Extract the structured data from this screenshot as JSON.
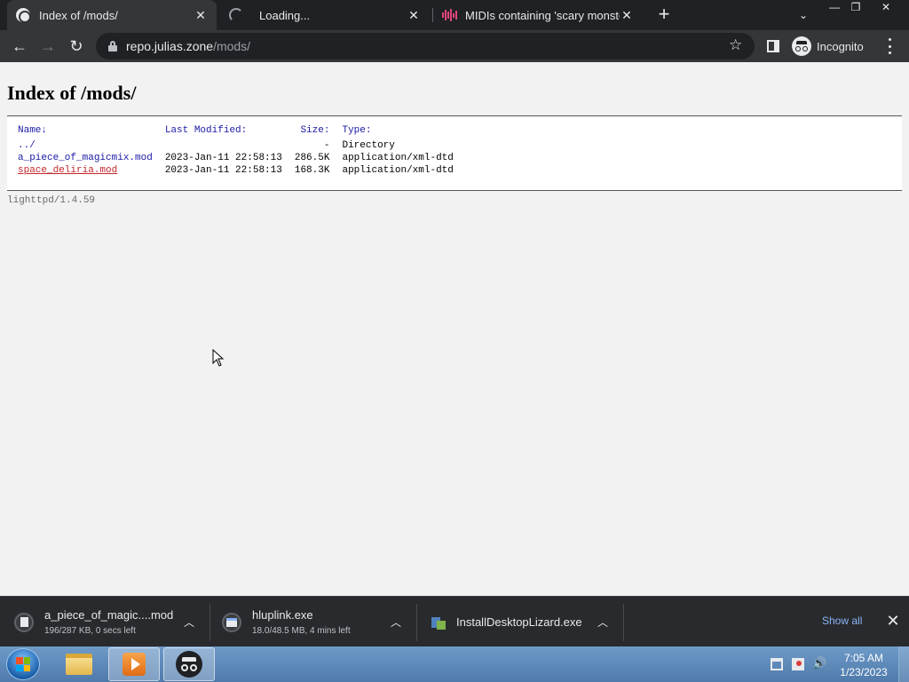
{
  "browser": {
    "tabs": [
      {
        "title": "Index of /mods/",
        "icon": "globe-icon",
        "active": true
      },
      {
        "title": "Loading...",
        "icon": "loading-spinner-icon",
        "active": false
      },
      {
        "title": "MIDIs containing 'scary monsters",
        "icon": "audio-wave-icon",
        "active": false
      }
    ],
    "new_tab_symbol": "+",
    "tab_search_symbol": "⌄",
    "window_controls": {
      "minimize": "—",
      "restore": "❐",
      "close": "✕"
    },
    "address_bar": {
      "host": "repo.julias.zone",
      "path": "/mods/"
    },
    "profile_label": "Incognito",
    "accent": "#8ab4f8"
  },
  "page": {
    "title": "Index of /mods/",
    "columns": {
      "name": "Name↓",
      "modified": "Last Modified:",
      "size": "Size:",
      "type": "Type:"
    },
    "rows": [
      {
        "name": "../",
        "modified": "",
        "size": "-",
        "type": "Directory",
        "visited": false
      },
      {
        "name": "a_piece_of_magicmix.mod",
        "modified": "2023-Jan-11 22:58:13",
        "size": "286.5K",
        "type": "application/xml-dtd",
        "visited": false
      },
      {
        "name": "space_deliria.mod",
        "modified": "2023-Jan-11 22:58:13",
        "size": "168.3K",
        "type": "application/xml-dtd",
        "visited": true
      }
    ],
    "server": "lighttpd/1.4.59"
  },
  "downloads": {
    "items": [
      {
        "name": "a_piece_of_magic....mod",
        "status": "196/287 KB, 0 secs left",
        "icon": "document-icon"
      },
      {
        "name": "hluplink.exe",
        "status": "18.0/48.5 MB, 4 mins left",
        "icon": "window-app-icon"
      },
      {
        "name": "InstallDesktopLizard.exe",
        "status": "",
        "icon": "installer-icon"
      }
    ],
    "show_all": "Show all",
    "close_symbol": "✕"
  },
  "taskbar": {
    "time": "7:05 AM",
    "date": "1/23/2023"
  }
}
